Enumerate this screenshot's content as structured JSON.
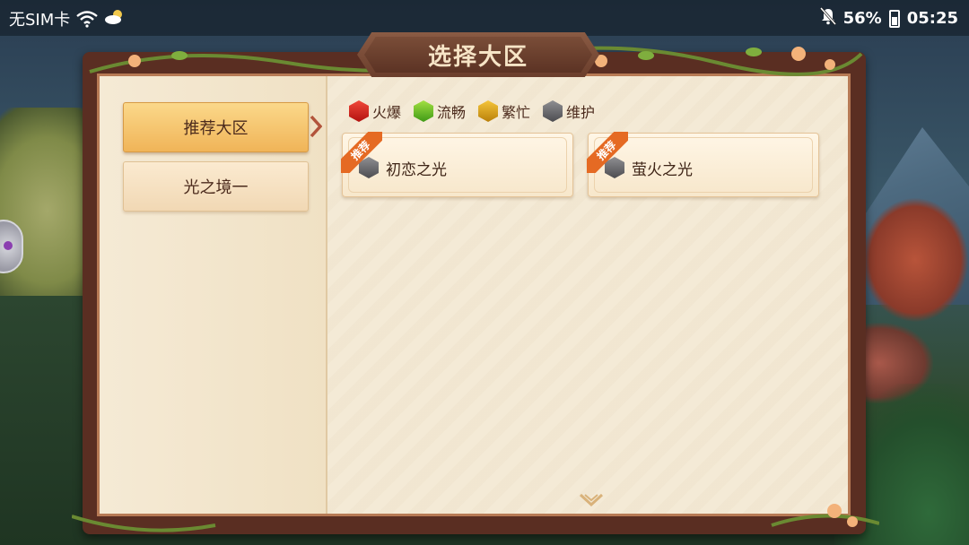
{
  "status_bar": {
    "carrier": "无SIM卡",
    "battery": "56%",
    "time": "05:25"
  },
  "dialog": {
    "title": "选择大区"
  },
  "tabs": [
    {
      "label": "推荐大区",
      "active": true
    },
    {
      "label": "光之境一",
      "active": false
    }
  ],
  "legend": [
    {
      "label": "火爆",
      "color": "#d42a20",
      "icon": "red-hex-icon"
    },
    {
      "label": "流畅",
      "color": "#62b82a",
      "icon": "green-hex-icon"
    },
    {
      "label": "繁忙",
      "color": "#d9a01b",
      "icon": "yellow-hex-icon"
    },
    {
      "label": "维护",
      "color": "#6c6c70",
      "icon": "gray-hex-icon"
    }
  ],
  "servers": [
    {
      "name": "初恋之光",
      "badge": "推荐",
      "status": "维护"
    },
    {
      "name": "萤火之光",
      "badge": "推荐",
      "status": "维护"
    }
  ]
}
